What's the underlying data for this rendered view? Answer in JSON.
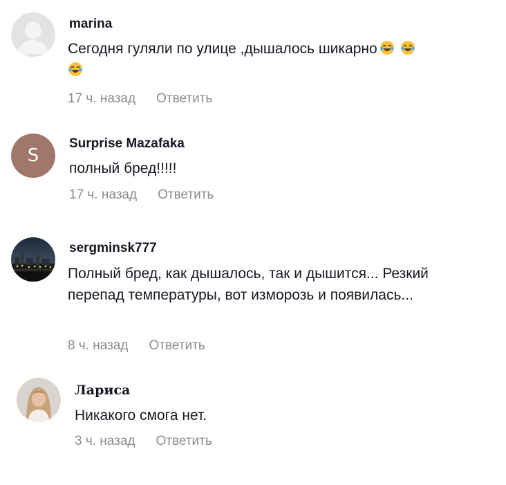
{
  "comments": [
    {
      "username": "marina",
      "text": "Сегодня гуляли по улице ,дышалось шикарно",
      "emojis": [
        "joy-icon",
        "joy-icon",
        "joy-icon"
      ],
      "time": "17 ч. назад",
      "reply_label": "Ответить"
    },
    {
      "username": "Surprise Mazafaka",
      "avatar_letter": "S",
      "text": "полный бред!!!!!",
      "time": "17 ч. назад",
      "reply_label": "Ответить"
    },
    {
      "username": "sergminsk777",
      "text": "Полный бред, как дышалось, так и дышится... Резкий перепад температуры, вот изморозь и появилась...",
      "time": "8 ч. назад",
      "reply_label": "Ответить"
    },
    {
      "username": "Лариса",
      "text": "Никакого смога нет.",
      "time": "3 ч. назад",
      "reply_label": "Ответить"
    }
  ],
  "colors": {
    "text": "#161823",
    "muted": "#8a8b91",
    "letter_avatar_bg": "#a1776b",
    "placeholder_avatar_bg": "#e3e3e3"
  }
}
